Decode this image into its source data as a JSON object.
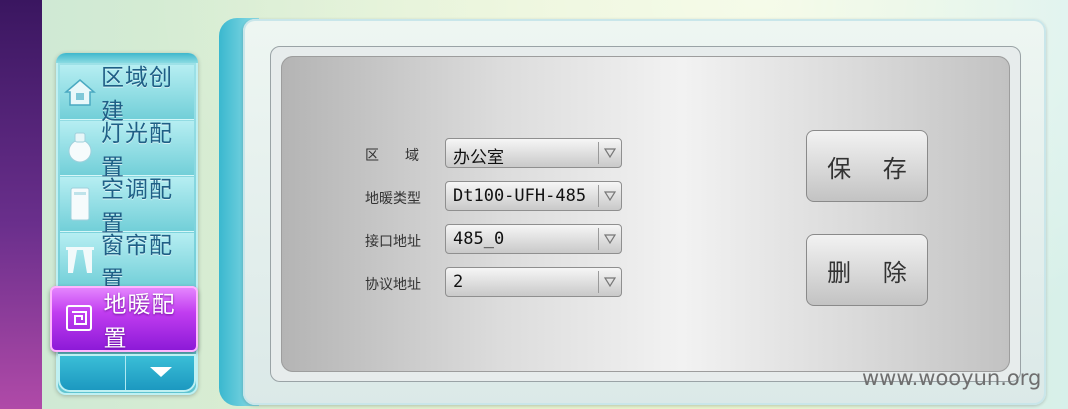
{
  "sidebar": {
    "items": [
      {
        "label": "区域创建",
        "icon": "house-icon"
      },
      {
        "label": "灯光配置",
        "icon": "bulb-icon"
      },
      {
        "label": "空调配置",
        "icon": "air-conditioner-icon"
      },
      {
        "label": "窗帘配置",
        "icon": "curtain-icon"
      }
    ],
    "active": {
      "label": "地暖配置",
      "icon": "floor-heating-icon"
    },
    "footer": {
      "down_icon": "chevron-down-icon"
    }
  },
  "form": {
    "fields": [
      {
        "label": "区　域",
        "value": "办公室"
      },
      {
        "label": "地暖类型",
        "value": "Dt100-UFH-485"
      },
      {
        "label": "接口地址",
        "value": "485_0"
      },
      {
        "label": "协议地址",
        "value": "2"
      }
    ],
    "dropdown_icon": "triangle-down-icon"
  },
  "buttons": {
    "save": "保 存",
    "delete": "删 除"
  },
  "watermark": "www.wooyun.org",
  "colors": {
    "sidebar": "#72cfd8",
    "active_item": "#c13df0",
    "panel": "#dcdcdc",
    "label_text": "#1f5f86"
  }
}
